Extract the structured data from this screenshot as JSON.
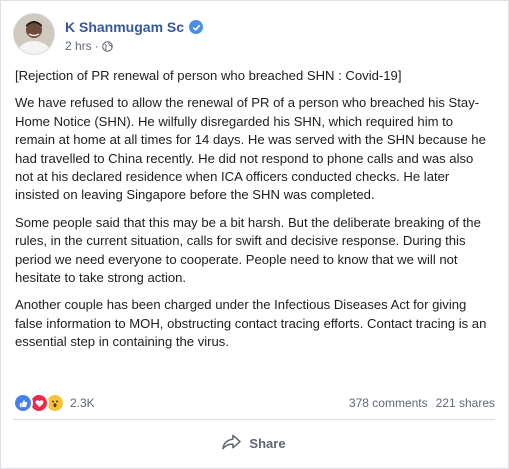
{
  "post": {
    "author": "K Shanmugam Sc",
    "time": "2 hrs",
    "separator": "·",
    "paragraphs": [
      "[Rejection of PR renewal of person who breached SHN : Covid-19]",
      "We have refused to allow the renewal of PR of a person who breached his Stay-Home Notice (SHN). He wilfully disregarded his SHN, which required him to remain at home at all times for 14 days. He was served with the SHN because he had travelled to China recently. He did not respond to phone calls and was also not at his declared residence when ICA officers conducted checks. He later insisted on leaving Singapore before the SHN was completed.",
      "Some people said that this may be a bit harsh. But the deliberate breaking of the rules, in the current situation, calls for swift and decisive response. During this period we need everyone to cooperate. People need to know that we will not hesitate to take strong action.",
      "Another couple has been charged under the Infectious Diseases Act for giving false information to MOH, obstructing contact tracing efforts. Contact tracing is an essential step in containing the virus."
    ]
  },
  "engagement": {
    "reaction_icons": [
      "like-icon",
      "love-icon",
      "wow-icon"
    ],
    "reaction_count": "2.3K",
    "comments": "378 comments",
    "shares": "221 shares"
  },
  "actions": {
    "share_label": "Share"
  },
  "colors": {
    "author_link": "#365899",
    "verified": "#4a90e2",
    "like": "#4a7ff0",
    "love": "#f0284a",
    "wow": "#f7c33a"
  }
}
